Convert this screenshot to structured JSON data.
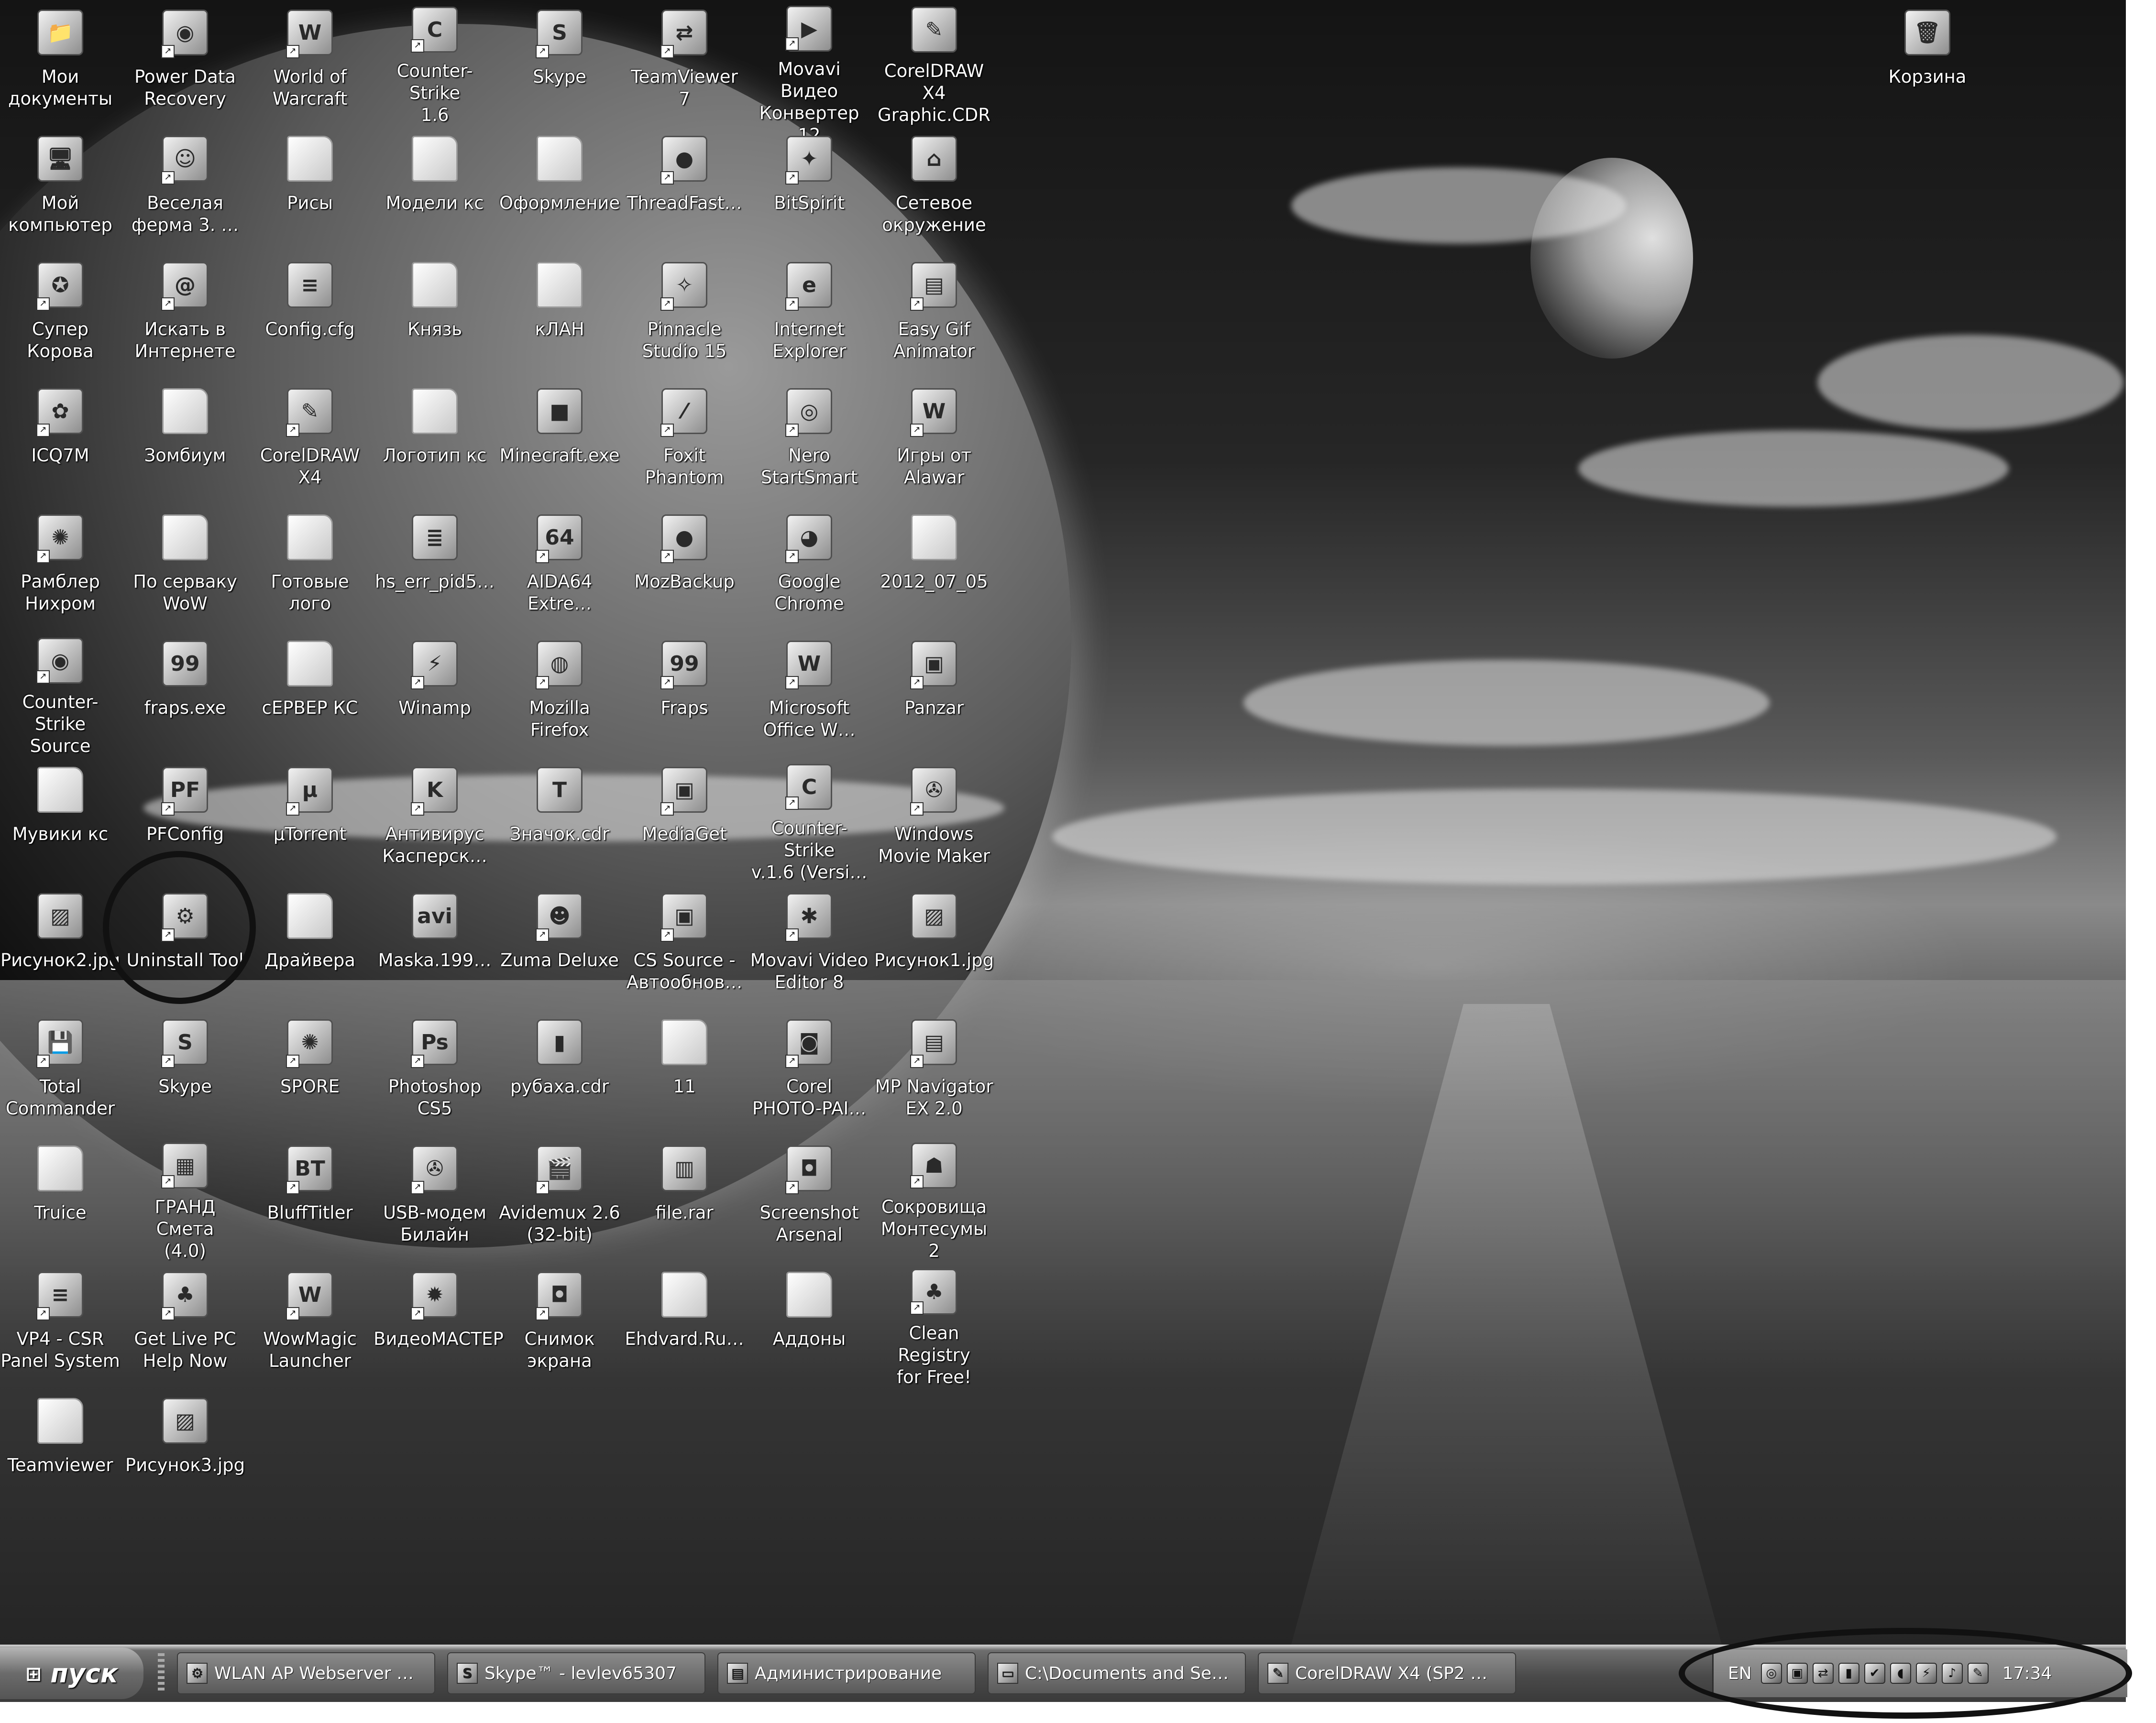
{
  "desktop": {
    "icons": [
      {
        "label": "Мои\nдокументы",
        "glyph": "📁",
        "type": "app",
        "shortcut": false
      },
      {
        "label": "Power Data\nRecovery",
        "glyph": "◉",
        "type": "app",
        "shortcut": true
      },
      {
        "label": "World of\nWarcraft",
        "glyph": "W",
        "type": "app",
        "shortcut": true
      },
      {
        "label": "Counter-Strike\n1.6",
        "glyph": "C",
        "type": "app",
        "shortcut": true
      },
      {
        "label": "Skype",
        "glyph": "S",
        "type": "app",
        "shortcut": true
      },
      {
        "label": "TeamViewer 7",
        "glyph": "⇄",
        "type": "app",
        "shortcut": true
      },
      {
        "label": "Movavi Видео\nКонвертер 12",
        "glyph": "▶",
        "type": "app",
        "shortcut": true
      },
      {
        "label": "CorelDRAW X4\nGraphic.CDR",
        "glyph": "✎",
        "type": "file",
        "shortcut": false
      },
      {
        "label": "Мой\nкомпьютер",
        "glyph": "🖥",
        "type": "app",
        "shortcut": false
      },
      {
        "label": "Веселая\nферма 3. …",
        "glyph": "☺",
        "type": "app",
        "shortcut": true
      },
      {
        "label": "Рисы",
        "glyph": "",
        "type": "folder",
        "shortcut": false
      },
      {
        "label": "Модели кс",
        "glyph": "",
        "type": "folder",
        "shortcut": false
      },
      {
        "label": "Оформление",
        "glyph": "",
        "type": "folder",
        "shortcut": false
      },
      {
        "label": "ThreadFast…",
        "glyph": "●",
        "type": "app",
        "shortcut": true
      },
      {
        "label": "BitSpirit",
        "glyph": "✦",
        "type": "app",
        "shortcut": true
      },
      {
        "label": "Сетевое\nокружение",
        "glyph": "⌂",
        "type": "app",
        "shortcut": false
      },
      {
        "label": "Супер Корова",
        "glyph": "✪",
        "type": "app",
        "shortcut": true
      },
      {
        "label": "Искать в\nИнтернете",
        "glyph": "@",
        "type": "app",
        "shortcut": true
      },
      {
        "label": "Config.cfg",
        "glyph": "≡",
        "type": "file",
        "shortcut": false
      },
      {
        "label": "Князь",
        "glyph": "",
        "type": "folder",
        "shortcut": false
      },
      {
        "label": "кЛАН",
        "glyph": "",
        "type": "folder",
        "shortcut": false
      },
      {
        "label": "Pinnacle\nStudio 15",
        "glyph": "✧",
        "type": "app",
        "shortcut": true
      },
      {
        "label": "Internet\nExplorer",
        "glyph": "e",
        "type": "app",
        "shortcut": true
      },
      {
        "label": "Easy Gif\nAnimator",
        "glyph": "▤",
        "type": "app",
        "shortcut": true
      },
      {
        "label": "ICQ7M",
        "glyph": "✿",
        "type": "app",
        "shortcut": true
      },
      {
        "label": "Зомбиум",
        "glyph": "",
        "type": "folder",
        "shortcut": false
      },
      {
        "label": "CorelDRAW X4",
        "glyph": "✎",
        "type": "app",
        "shortcut": true
      },
      {
        "label": "Логотип кс",
        "glyph": "",
        "type": "folder",
        "shortcut": false
      },
      {
        "label": "Minecraft.exe",
        "glyph": "■",
        "type": "app",
        "shortcut": false
      },
      {
        "label": "Foxit Phantom",
        "glyph": "⁄",
        "type": "app",
        "shortcut": true
      },
      {
        "label": "Nero\nStartSmart",
        "glyph": "◎",
        "type": "app",
        "shortcut": true
      },
      {
        "label": "Игры от\nAlawar",
        "glyph": "W",
        "type": "app",
        "shortcut": true
      },
      {
        "label": "Рамблер\nНихром",
        "glyph": "✺",
        "type": "app",
        "shortcut": true
      },
      {
        "label": "По серваку\nWoW",
        "glyph": "",
        "type": "folder",
        "shortcut": false
      },
      {
        "label": "Готовые лого",
        "glyph": "",
        "type": "folder",
        "shortcut": false
      },
      {
        "label": "hs_err_pid5…",
        "glyph": "≣",
        "type": "file",
        "shortcut": false
      },
      {
        "label": "AIDA64\nExtre…",
        "glyph": "64",
        "type": "app",
        "shortcut": true
      },
      {
        "label": "MozBackup",
        "glyph": "●",
        "type": "app",
        "shortcut": true
      },
      {
        "label": "Google\nChrome",
        "glyph": "◕",
        "type": "app",
        "shortcut": true
      },
      {
        "label": "2012_07_05",
        "glyph": "",
        "type": "folder",
        "shortcut": false
      },
      {
        "label": "Counter-Strike\nSource",
        "glyph": "◉",
        "type": "app",
        "shortcut": true
      },
      {
        "label": "fraps.exe",
        "glyph": "99",
        "type": "app",
        "shortcut": false
      },
      {
        "label": "сЕРВЕР КС",
        "glyph": "",
        "type": "folder",
        "shortcut": false
      },
      {
        "label": "Winamp",
        "glyph": "⚡",
        "type": "app",
        "shortcut": true
      },
      {
        "label": "Mozilla Firefox",
        "glyph": "◍",
        "type": "app",
        "shortcut": true
      },
      {
        "label": "Fraps",
        "glyph": "99",
        "type": "app",
        "shortcut": true
      },
      {
        "label": "Microsoft\nOffice W…",
        "glyph": "W",
        "type": "app",
        "shortcut": true
      },
      {
        "label": "Panzar",
        "glyph": "▣",
        "type": "app",
        "shortcut": true
      },
      {
        "label": "Мувики кс",
        "glyph": "",
        "type": "folder",
        "shortcut": false
      },
      {
        "label": "PFConfig",
        "glyph": "PF",
        "type": "app",
        "shortcut": true
      },
      {
        "label": "µTorrent",
        "glyph": "µ",
        "type": "app",
        "shortcut": true
      },
      {
        "label": "Антивирус\nКасперск…",
        "glyph": "K",
        "type": "app",
        "shortcut": true
      },
      {
        "label": "Значок.cdr",
        "glyph": "T",
        "type": "file",
        "shortcut": false
      },
      {
        "label": "MediaGet",
        "glyph": "▣",
        "type": "app",
        "shortcut": true
      },
      {
        "label": "Counter-Strike\nv.1.6 (Versi…",
        "glyph": "C",
        "type": "app",
        "shortcut": true
      },
      {
        "label": "Windows\nMovie Maker",
        "glyph": "✇",
        "type": "app",
        "shortcut": true
      },
      {
        "label": "Рисунок2.jpg",
        "glyph": "▨",
        "type": "file",
        "shortcut": false
      },
      {
        "label": "Uninstall Tool",
        "glyph": "⚙",
        "type": "app",
        "shortcut": true
      },
      {
        "label": "Драйвера",
        "glyph": "",
        "type": "folder",
        "shortcut": false
      },
      {
        "label": "Maska.199…",
        "glyph": "avi",
        "type": "file",
        "shortcut": false
      },
      {
        "label": "Zuma Deluxe",
        "glyph": "☻",
        "type": "app",
        "shortcut": true
      },
      {
        "label": "CS Source -\nАвтообнов…",
        "glyph": "▣",
        "type": "app",
        "shortcut": true
      },
      {
        "label": "Movavi Video\nEditor 8",
        "glyph": "✱",
        "type": "app",
        "shortcut": true
      },
      {
        "label": "Рисунок1.jpg",
        "glyph": "▨",
        "type": "file",
        "shortcut": false
      },
      {
        "label": "Total\nCommander",
        "glyph": "💾",
        "type": "app",
        "shortcut": true
      },
      {
        "label": "Skype",
        "glyph": "S",
        "type": "app",
        "shortcut": true
      },
      {
        "label": "SPORE",
        "glyph": "✺",
        "type": "app",
        "shortcut": true
      },
      {
        "label": "Photoshop\nCS5",
        "glyph": "Ps",
        "type": "app",
        "shortcut": true
      },
      {
        "label": "рубаха.cdr",
        "glyph": "▮",
        "type": "file",
        "shortcut": false
      },
      {
        "label": "11",
        "glyph": "",
        "type": "folder",
        "shortcut": false
      },
      {
        "label": "Corel\nPHOTO-PAI…",
        "glyph": "◙",
        "type": "app",
        "shortcut": true
      },
      {
        "label": "MP Navigator\nEX 2.0",
        "glyph": "▤",
        "type": "app",
        "shortcut": true
      },
      {
        "label": "Truice",
        "glyph": "",
        "type": "folder",
        "shortcut": false
      },
      {
        "label": "ГРАНД Смета\n(4.0)",
        "glyph": "▦",
        "type": "app",
        "shortcut": true
      },
      {
        "label": "BluffTitler",
        "glyph": "BT",
        "type": "app",
        "shortcut": true
      },
      {
        "label": "USB-модем\nБилайн",
        "glyph": "✇",
        "type": "app",
        "shortcut": true
      },
      {
        "label": "Avidemux 2.6\n(32-bit)",
        "glyph": "🎬",
        "type": "app",
        "shortcut": true
      },
      {
        "label": "file.rar",
        "glyph": "▥",
        "type": "file",
        "shortcut": false
      },
      {
        "label": "Screenshot\nArsenal",
        "glyph": "◘",
        "type": "app",
        "shortcut": true
      },
      {
        "label": "Сокровища\nМонтесумы 2",
        "glyph": "☗",
        "type": "app",
        "shortcut": true
      },
      {
        "label": "VP4 - CSR\nPanel System",
        "glyph": "≡",
        "type": "app",
        "shortcut": true
      },
      {
        "label": "Get Live PC\nHelp Now",
        "glyph": "♣",
        "type": "app",
        "shortcut": true
      },
      {
        "label": "WowMagic\nLauncher",
        "glyph": "W",
        "type": "app",
        "shortcut": true
      },
      {
        "label": "ВидеоМАСТЕР",
        "glyph": "✹",
        "type": "app",
        "shortcut": true
      },
      {
        "label": "Снимок\nэкрана",
        "glyph": "◘",
        "type": "app",
        "shortcut": true
      },
      {
        "label": "Ehdvard.Ru…",
        "glyph": "",
        "type": "folder",
        "shortcut": false
      },
      {
        "label": "Аддоны",
        "glyph": "",
        "type": "folder",
        "shortcut": false
      },
      {
        "label": "Clean Registry\nfor Free!",
        "glyph": "♣",
        "type": "app",
        "shortcut": true
      },
      {
        "label": "Teamviewer",
        "glyph": "",
        "type": "folder",
        "shortcut": false
      },
      {
        "label": "Рисунок3.jpg",
        "glyph": "▨",
        "type": "file",
        "shortcut": false
      }
    ],
    "recycle_bin": {
      "label": "Корзина",
      "glyph": "🗑"
    }
  },
  "taskbar": {
    "start_label": "пуск",
    "tasks": [
      {
        "label": "WLAN AP Webserver …",
        "glyph": "⚙"
      },
      {
        "label": "Skype™ - levlev65307",
        "glyph": "S"
      },
      {
        "label": "Администрирование",
        "glyph": "▤"
      },
      {
        "label": "C:\\Documents and Se…",
        "glyph": "▭"
      },
      {
        "label": "CorelDRAW X4 (SP2 …",
        "glyph": "✎"
      }
    ],
    "tray": {
      "language": "EN",
      "icons": [
        "◎",
        "▣",
        "⇄",
        "▮",
        "✔",
        "◖",
        "⚡",
        "♪",
        "✎"
      ],
      "clock": "17:34"
    }
  }
}
